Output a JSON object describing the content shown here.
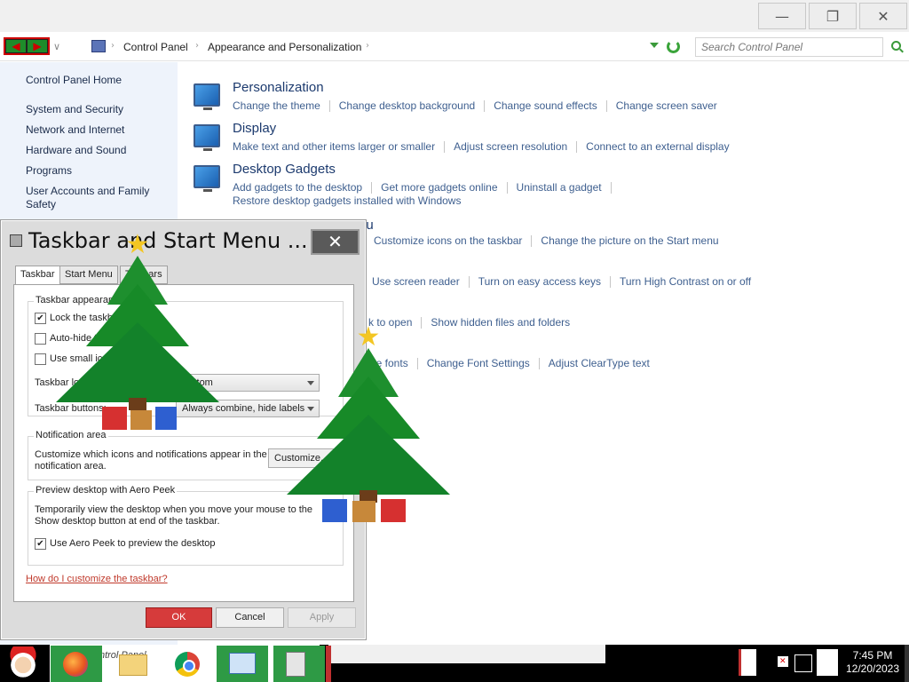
{
  "window": {
    "controls": {
      "minimize": "—",
      "maximize": "❐",
      "close": "✕"
    }
  },
  "address_bar": {
    "back": "◀",
    "forward": "▶",
    "dropdown": "∨",
    "breadcrumbs": [
      "Control Panel",
      "Appearance and Personalization"
    ],
    "separator": "›",
    "search_placeholder": "Search Control Panel"
  },
  "sidebar": {
    "items": [
      "Control Panel Home",
      "System and Security",
      "Network and Internet",
      "Hardware and Sound",
      "Programs",
      "User Accounts and Family Safety"
    ]
  },
  "categories": [
    {
      "title": "Personalization",
      "icon": "personalization-icon",
      "links": [
        "Change the theme",
        "Change desktop background",
        "Change sound effects",
        "Change screen saver"
      ]
    },
    {
      "title": "Display",
      "icon": "display-icon",
      "links": [
        "Make text and other items larger or smaller",
        "Adjust screen resolution",
        "Connect to an external display"
      ]
    },
    {
      "title": "Desktop Gadgets",
      "icon": "gadgets-icon",
      "links": [
        "Add gadgets to the desktop",
        "Get more gadgets online",
        "Uninstall a gadget"
      ],
      "links_row2": [
        "Restore desktop gadgets installed with Windows"
      ]
    }
  ],
  "partial_rows": {
    "taskbar_title_tail": "nu",
    "taskbar_links": [
      "Customize icons on the taskbar",
      "Change the picture on the Start menu"
    ],
    "ease_links": [
      "Use screen reader",
      "Turn on easy access keys",
      "Turn High Contrast on or off"
    ],
    "folder_links": [
      "k to open",
      "Show hidden files and folders"
    ],
    "fonts_links": [
      "le fonts",
      "Change Font Settings",
      "Adjust ClearType text"
    ]
  },
  "dialog": {
    "title": "Taskbar and Start Menu ...",
    "close": "✕",
    "tabs": [
      "Taskbar",
      "Start Menu",
      "Toolbars"
    ],
    "taskbar_appearance": {
      "label": "Taskbar appearance",
      "options": [
        {
          "label": "Lock the taskbar",
          "checked": true
        },
        {
          "label": "Auto-hide the taskbar",
          "checked": false
        },
        {
          "label": "Use small icons",
          "checked": false
        }
      ],
      "location_label": "Taskbar location on screen:",
      "location_value": "Bottom",
      "buttons_label": "Taskbar buttons:",
      "buttons_value": "Always combine, hide labels"
    },
    "notification_area": {
      "label": "Notification area",
      "text": "Customize which icons and notifications appear in the notification area.",
      "button": "Customize..."
    },
    "aero_peek": {
      "label": "Preview desktop with Aero Peek",
      "text": "Temporarily view the desktop when you move your mouse to the Show desktop button at end of the taskbar.",
      "checkbox": "Use Aero Peek to preview the desktop",
      "checked": true
    },
    "help_link": "How do I customize the taskbar?",
    "buttons": {
      "ok": "OK",
      "cancel": "Cancel",
      "apply": "Apply"
    },
    "check_glyph": "✔"
  },
  "taskbar": {
    "search_text": "Search Control Panel",
    "clock_time": "7:45 PM",
    "clock_date": "12/20/2023"
  },
  "decorations": {
    "tree_star": "★"
  }
}
